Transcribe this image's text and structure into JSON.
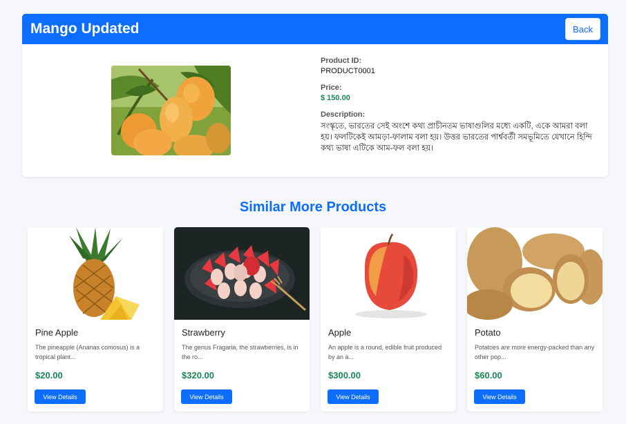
{
  "product": {
    "title": "Mango Updated",
    "back_label": "Back",
    "id_label": "Product ID:",
    "id_value": "PRODUCT0001",
    "price_label": "Price:",
    "price_value": "$ 150.00",
    "description_label": "Description:",
    "description_value": "সংস্কৃতে, ভারতের সেই অংশে কথ্য প্রাচীনতম ভাষাগুলির মধ্যে একটি, একে আমরা বলা হয়। ফলটিকেই আমড়া-ফালাম বলা হয়। উত্তর ভারতের পার্শ্ববর্তী সমভূমিতে যেখানে হিন্দি কথ্য ভাষা এটিকে আম-ফল বলা হয়।",
    "image_icon": "mango-photo"
  },
  "similar": {
    "heading": "Similar More Products",
    "items": [
      {
        "name": "Pine Apple",
        "description": "The pineapple (Ananas comosus) is a tropical plant...",
        "price": "$20.00",
        "button_label": "View Details",
        "image_icon": "pineapple-photo"
      },
      {
        "name": "Strawberry",
        "description": "The genus Fragaria, the strawberries, is in the ro...",
        "price": "$320.00",
        "button_label": "View Details",
        "image_icon": "strawberry-photo"
      },
      {
        "name": "Apple",
        "description": "An apple is a round, edible fruit produced by an a...",
        "price": "$300.00",
        "button_label": "View Details",
        "image_icon": "apple-photo"
      },
      {
        "name": "Potato",
        "description": "Potatoes are more energy-packed than any other pop...",
        "price": "$60.00",
        "button_label": "View Details",
        "image_icon": "potato-photo"
      }
    ]
  },
  "colors": {
    "primary": "#0d6efd",
    "price_green": "#198754",
    "background": "#f5f7fa"
  }
}
